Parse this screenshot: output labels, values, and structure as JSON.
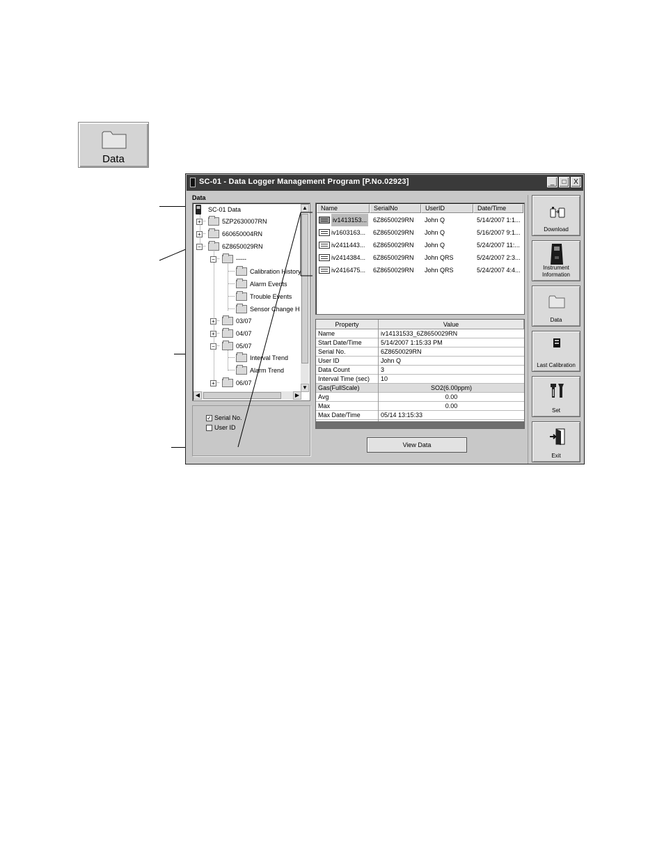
{
  "launcher": {
    "label": "Data"
  },
  "window": {
    "title": "SC-01 - Data Logger Management Program [P.No.02923]",
    "controls": {
      "minimize": "_",
      "maximize": "□",
      "close": "X"
    }
  },
  "left_panel": {
    "label": "Data",
    "tree": [
      {
        "label": "SC-01 Data"
      },
      {
        "label": "5ZP2630007RN"
      },
      {
        "label": "660650004RN"
      },
      {
        "label": "6Z8650029RN"
      },
      {
        "label": "-----"
      },
      {
        "label": "Calibration History"
      },
      {
        "label": "Alarm Events"
      },
      {
        "label": "Trouble Events"
      },
      {
        "label": "Sensor Change H"
      },
      {
        "label": "03/07"
      },
      {
        "label": "04/07"
      },
      {
        "label": "05/07"
      },
      {
        "label": "Interval Trend"
      },
      {
        "label": "Alarm Trend"
      },
      {
        "label": "06/07"
      }
    ],
    "filters": [
      {
        "label": "Serial No.",
        "checked": true,
        "mark": "✓"
      },
      {
        "label": "User ID",
        "checked": false,
        "mark": ""
      }
    ]
  },
  "file_list": {
    "columns": [
      "Name",
      "SerialNo",
      "UserID",
      "Date/Time"
    ],
    "rows": [
      {
        "name": "iv1413153...",
        "serial": "6Z8650029RN",
        "user": "John Q",
        "date": "5/14/2007 1:1..."
      },
      {
        "name": "iv1603163...",
        "serial": "6Z8650029RN",
        "user": "John Q",
        "date": "5/16/2007 9:1..."
      },
      {
        "name": "iv2411443...",
        "serial": "6Z8650029RN",
        "user": "John Q",
        "date": "5/24/2007 11:..."
      },
      {
        "name": "iv2414384...",
        "serial": "6Z8650029RN",
        "user": "John QRS",
        "date": "5/24/2007 2:3..."
      },
      {
        "name": "iv2416475...",
        "serial": "6Z8650029RN",
        "user": "John QRS",
        "date": "5/24/2007 4:4..."
      }
    ]
  },
  "properties": {
    "headers": [
      "Property",
      "Value"
    ],
    "rows": [
      {
        "k": "Name",
        "v": "iv14131533_6Z8650029RN"
      },
      {
        "k": "Start Date/Time",
        "v": "5/14/2007 1:15:33 PM"
      },
      {
        "k": "Serial No.",
        "v": "6Z8650029RN"
      },
      {
        "k": "User ID",
        "v": "John Q"
      },
      {
        "k": "Data Count",
        "v": "3"
      },
      {
        "k": "Interval Time (sec)",
        "v": "10"
      },
      {
        "k": "Gas(FullScale)",
        "v": "SO2(6.00ppm)"
      },
      {
        "k": "Avg",
        "v": "0.00"
      },
      {
        "k": "Max",
        "v": "0.00"
      },
      {
        "k": "Max Date/Time",
        "v": "05/14 13:15:33"
      }
    ]
  },
  "view_data_button": "View Data",
  "sidebar": [
    {
      "label": "Download",
      "icon": "download-icon"
    },
    {
      "label": "Instrument Information",
      "icon": "instrument-icon"
    },
    {
      "label": "Data",
      "icon": "folder-icon"
    },
    {
      "label": "Last Calibration",
      "icon": "calibration-icon"
    },
    {
      "label": "Set",
      "icon": "tools-icon"
    },
    {
      "label": "Exit",
      "icon": "exit-icon"
    }
  ]
}
